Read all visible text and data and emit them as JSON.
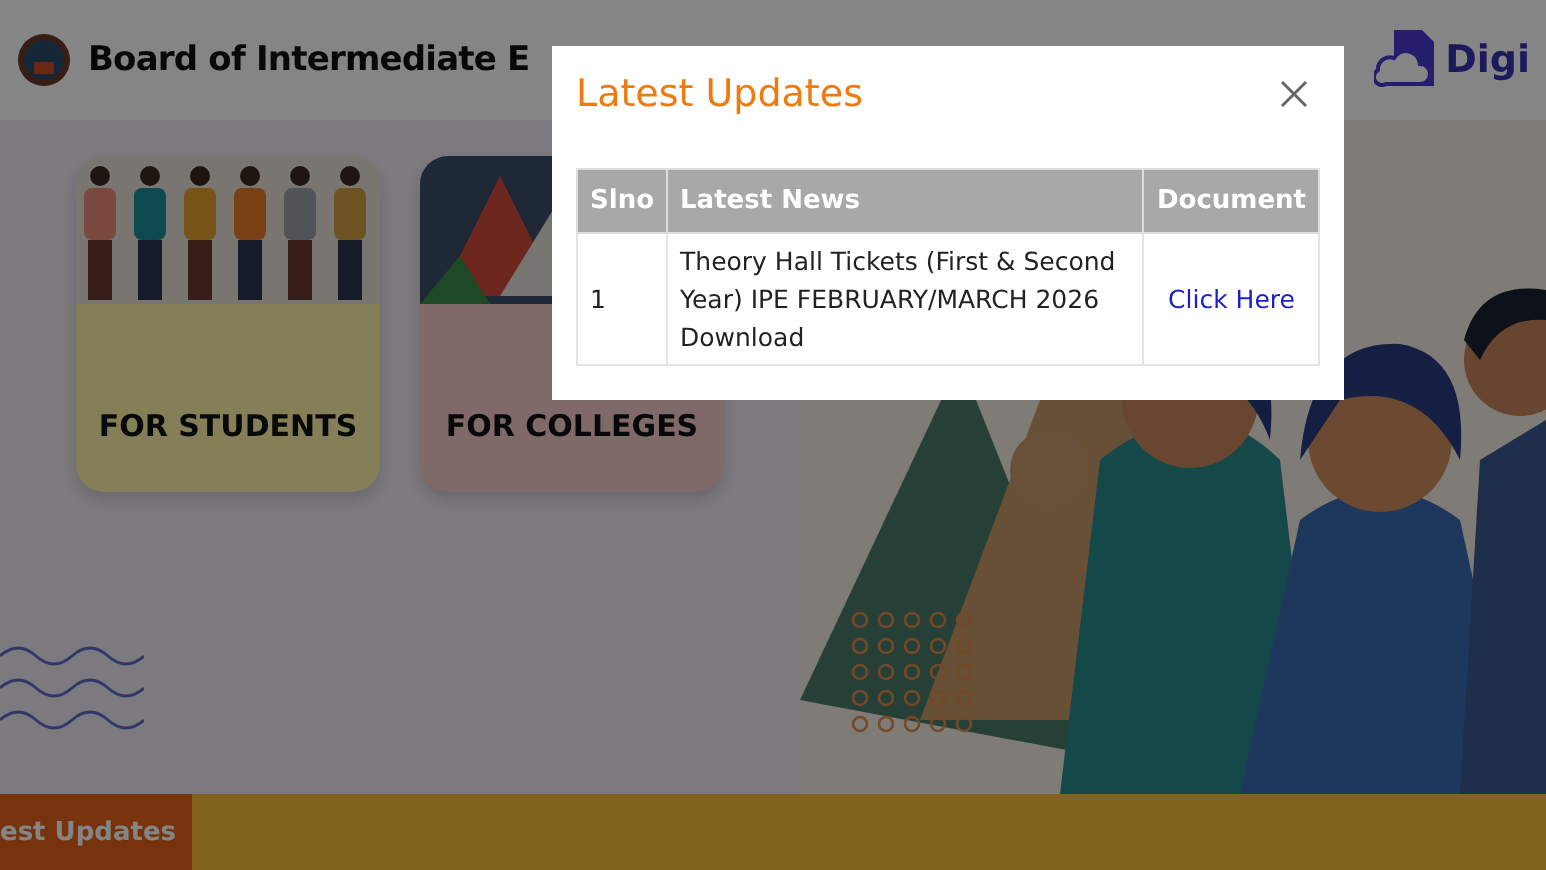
{
  "header": {
    "title": "Board of Intermediate E",
    "partner_logo_text": "Digi"
  },
  "cards": [
    {
      "kind": "students",
      "label": "FOR STUDENTS"
    },
    {
      "kind": "colleges",
      "label": "FOR COLLEGES"
    }
  ],
  "ticker": {
    "label": "est Updates"
  },
  "modal": {
    "title": "Latest Updates",
    "table": {
      "columns": [
        "Slno",
        "Latest News",
        "Document"
      ],
      "rows": [
        {
          "slno": "1",
          "news": "Theory Hall Tickets (First & Second Year) IPE FEBRUARY/MARCH 2026 Download",
          "document": "Click Here"
        }
      ]
    }
  }
}
